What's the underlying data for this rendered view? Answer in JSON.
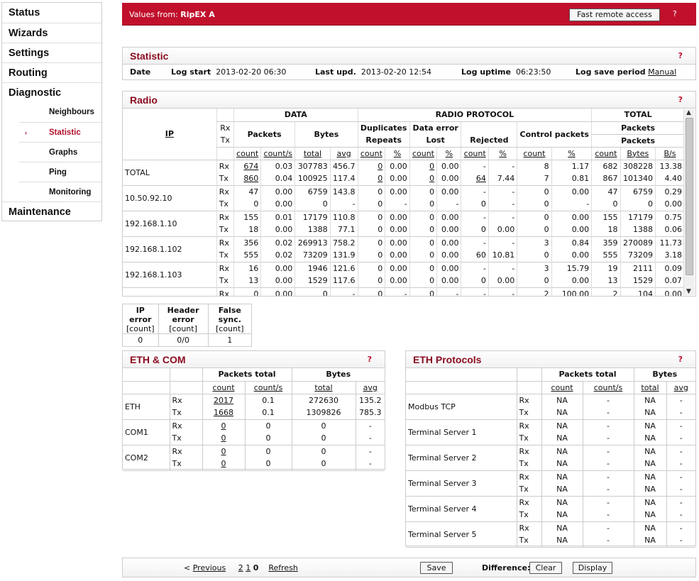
{
  "menu": {
    "status": "Status",
    "wizards": "Wizards",
    "settings": "Settings",
    "routing": "Routing",
    "diagnostic": "Diagnostic",
    "sub": [
      "Neighbours",
      "Statistic",
      "Graphs",
      "Ping",
      "Monitoring"
    ],
    "maintenance": "Maintenance",
    "active_arrow": "›"
  },
  "topbar": {
    "values_from": "Values from:",
    "device": "RipEX A",
    "fast_remote": "Fast remote access",
    "help": "?"
  },
  "statistic": {
    "title": "Statistic",
    "help": "?",
    "date_label": "Date",
    "log_start_label": "Log start",
    "log_start": "2013-02-20 06:30",
    "last_upd_label": "Last upd.",
    "last_upd": "2013-02-20 12:54",
    "log_uptime_label": "Log uptime",
    "log_uptime": "06:23:50",
    "log_save_label": "Log save period",
    "log_save": "Manual"
  },
  "radio": {
    "title": "Radio",
    "help": "?",
    "hdr": {
      "ip": "IP",
      "rx": "Rx",
      "tx": "Tx",
      "data": "DATA",
      "radio_protocol": "RADIO PROTOCOL",
      "total": "TOTAL",
      "packets": "Packets",
      "bytes": "Bytes",
      "duplicates": "Duplicates",
      "repeats": "Repeats",
      "data_error": "Data error",
      "lost": "Lost",
      "rejected": "Rejected",
      "control_packets": "Control packets",
      "tot_packets1": "Packets",
      "tot_packets2": "Packets",
      "sub": [
        "count",
        "count/s",
        "total",
        "avg",
        "count",
        "%",
        "count",
        "%",
        "count",
        "%",
        "count",
        "%",
        "count",
        "Bytes",
        "B/s"
      ]
    },
    "rows": [
      {
        "ip": "TOTAL",
        "rx": [
          "Rx",
          "674",
          "0.03",
          "307783",
          "456.7",
          "0",
          "0.00",
          "0",
          "0.00",
          "-",
          "-",
          "8",
          "1.17",
          "682",
          "308228",
          "13.38"
        ],
        "tx": [
          "Tx",
          "860",
          "0.04",
          "100925",
          "117.4",
          "0",
          "0.00",
          "0",
          "0.00",
          "64",
          "7.44",
          "7",
          "0.81",
          "867",
          "101340",
          "4.40"
        ]
      },
      {
        "ip": "10.50.92.10",
        "rx": [
          "Rx",
          "47",
          "0.00",
          "6759",
          "143.8",
          "0",
          "0.00",
          "0",
          "0.00",
          "-",
          "-",
          "0",
          "0.00",
          "47",
          "6759",
          "0.29"
        ],
        "tx": [
          "Tx",
          "0",
          "0.00",
          "0",
          "-",
          "0",
          "-",
          "0",
          "-",
          "0",
          "-",
          "0",
          "-",
          "0",
          "0",
          "0.00"
        ]
      },
      {
        "ip": "192.168.1.10",
        "rx": [
          "Rx",
          "155",
          "0.01",
          "17179",
          "110.8",
          "0",
          "0.00",
          "0",
          "0.00",
          "-",
          "-",
          "0",
          "0.00",
          "155",
          "17179",
          "0.75"
        ],
        "tx": [
          "Tx",
          "18",
          "0.00",
          "1388",
          "77.1",
          "0",
          "0.00",
          "0",
          "0.00",
          "0",
          "0.00",
          "0",
          "0.00",
          "18",
          "1388",
          "0.06"
        ]
      },
      {
        "ip": "192.168.1.102",
        "rx": [
          "Rx",
          "356",
          "0.02",
          "269913",
          "758.2",
          "0",
          "0.00",
          "0",
          "0.00",
          "-",
          "-",
          "3",
          "0.84",
          "359",
          "270089",
          "11.73"
        ],
        "tx": [
          "Tx",
          "555",
          "0.02",
          "73209",
          "131.9",
          "0",
          "0.00",
          "0",
          "0.00",
          "60",
          "10.81",
          "0",
          "0.00",
          "555",
          "73209",
          "3.18"
        ]
      },
      {
        "ip": "192.168.1.103",
        "rx": [
          "Rx",
          "16",
          "0.00",
          "1946",
          "121.6",
          "0",
          "0.00",
          "0",
          "0.00",
          "-",
          "-",
          "3",
          "15.79",
          "19",
          "2111",
          "0.09"
        ],
        "tx": [
          "Tx",
          "13",
          "0.00",
          "1529",
          "117.6",
          "0",
          "0.00",
          "0",
          "0.00",
          "0",
          "0.00",
          "0",
          "0.00",
          "13",
          "1529",
          "0.07"
        ]
      },
      {
        "ip": "",
        "rx": [
          "Rx",
          "0",
          "0.00",
          "0",
          "-",
          "0",
          "-",
          "0",
          "-",
          "-",
          "-",
          "2",
          "100.00",
          "2",
          "104",
          "0.00"
        ],
        "tx": null
      }
    ]
  },
  "errors": {
    "h1": "IP error",
    "h2": "Header error",
    "h3": "False sync.",
    "u1": "[count]",
    "u2": "[count]",
    "u3": "[count]",
    "v1": "0",
    "v2": "0/0",
    "v3": "1"
  },
  "ethcom": {
    "title": "ETH & COM",
    "help": "?",
    "packets_total": "Packets total",
    "bytes": "Bytes",
    "sub": [
      "count",
      "count/s",
      "total",
      "avg"
    ],
    "rows": [
      {
        "name": "ETH",
        "rx": [
          "Rx",
          "2017",
          "0.1",
          "272630",
          "135.2"
        ],
        "tx": [
          "Tx",
          "1668",
          "0.1",
          "1309826",
          "785.3"
        ]
      },
      {
        "name": "COM1",
        "rx": [
          "Rx",
          "0",
          "0",
          "0",
          "-"
        ],
        "tx": [
          "Tx",
          "0",
          "0",
          "0",
          "-"
        ]
      },
      {
        "name": "COM2",
        "rx": [
          "Rx",
          "0",
          "0",
          "0",
          "-"
        ],
        "tx": [
          "Tx",
          "0",
          "0",
          "0",
          "-"
        ]
      }
    ]
  },
  "ethproto": {
    "title": "ETH Protocols",
    "help": "?",
    "packets_total": "Packets total",
    "bytes": "Bytes",
    "sub": [
      "count",
      "count/s",
      "total",
      "avg"
    ],
    "rows": [
      {
        "name": "Modbus TCP",
        "rx": [
          "Rx",
          "NA",
          "-",
          "NA",
          "-"
        ],
        "tx": [
          "Tx",
          "NA",
          "-",
          "NA",
          "-"
        ]
      },
      {
        "name": "Terminal Server 1",
        "rx": [
          "Rx",
          "NA",
          "-",
          "NA",
          "-"
        ],
        "tx": [
          "Tx",
          "NA",
          "-",
          "NA",
          "-"
        ]
      },
      {
        "name": "Terminal Server 2",
        "rx": [
          "Rx",
          "NA",
          "-",
          "NA",
          "-"
        ],
        "tx": [
          "Tx",
          "NA",
          "-",
          "NA",
          "-"
        ]
      },
      {
        "name": "Terminal Server 3",
        "rx": [
          "Rx",
          "NA",
          "-",
          "NA",
          "-"
        ],
        "tx": [
          "Tx",
          "NA",
          "-",
          "NA",
          "-"
        ]
      },
      {
        "name": "Terminal Server 4",
        "rx": [
          "Rx",
          "NA",
          "-",
          "NA",
          "-"
        ],
        "tx": [
          "Tx",
          "NA",
          "-",
          "NA",
          "-"
        ]
      },
      {
        "name": "Terminal Server 5",
        "rx": [
          "Rx",
          "NA",
          "-",
          "NA",
          "-"
        ],
        "tx": [
          "Tx",
          "NA",
          "-",
          "NA",
          "-"
        ]
      }
    ]
  },
  "bottom": {
    "prev_arrow": "<",
    "previous": "Previous",
    "pages": [
      "2",
      "1",
      "0"
    ],
    "refresh": "Refresh",
    "save": "Save",
    "difference": "Difference:",
    "clear": "Clear",
    "display": "Display"
  },
  "colors": {
    "accent": "#c0102c",
    "title": "#8a0a1f"
  }
}
